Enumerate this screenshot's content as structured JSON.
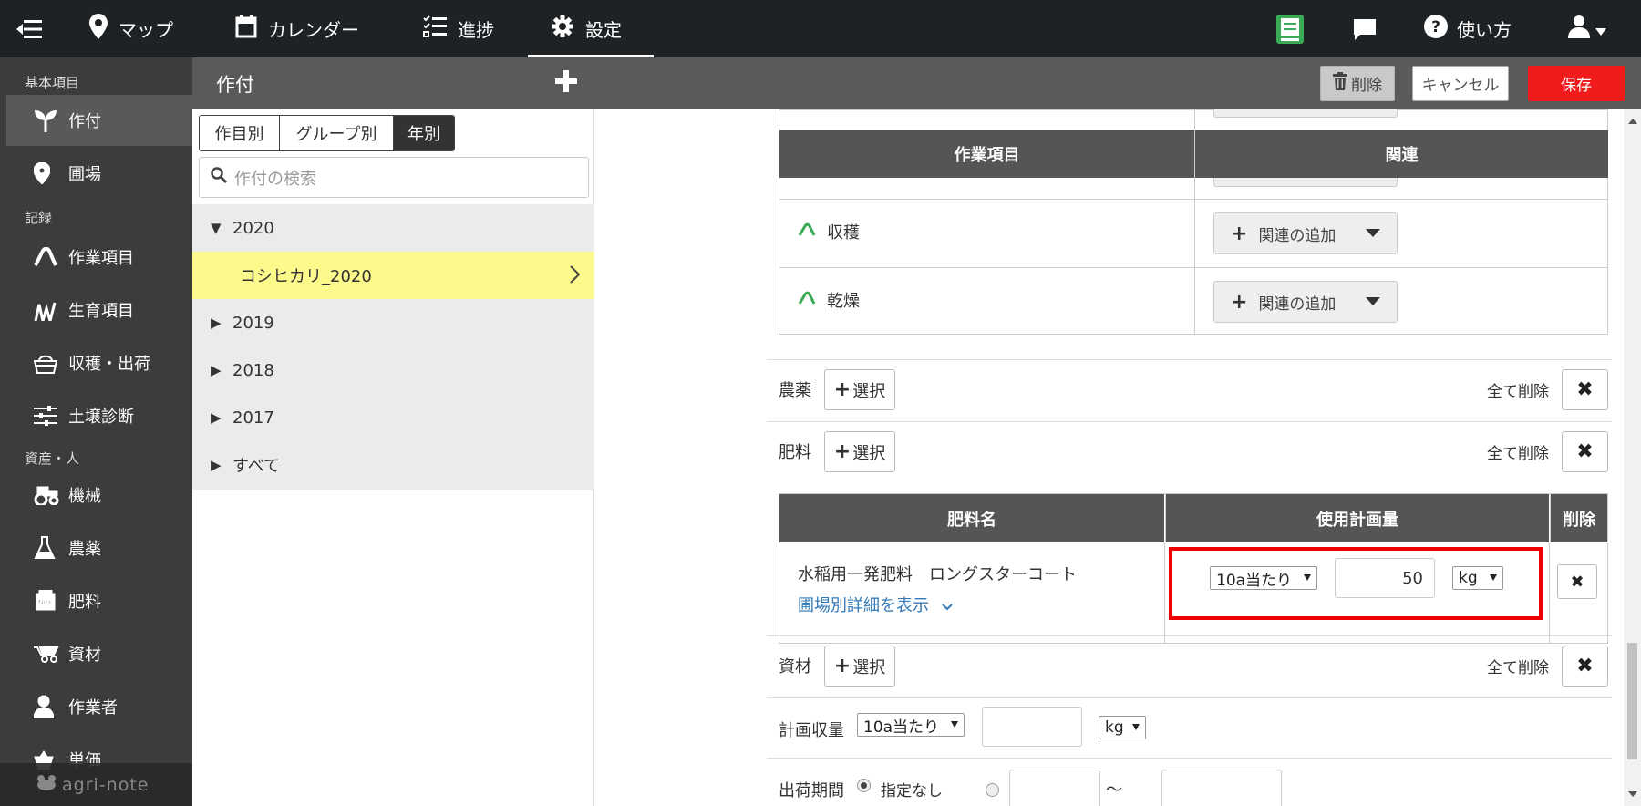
{
  "topbar": {
    "menu_icon": "collapse-menu-icon",
    "nav": [
      {
        "label": "マップ",
        "icon": "map-pin-icon"
      },
      {
        "label": "カレンダー",
        "icon": "calendar-icon"
      },
      {
        "label": "進捗",
        "icon": "checklist-icon"
      },
      {
        "label": "設定",
        "icon": "gear-icon"
      }
    ],
    "help_label": "使い方",
    "colors": {
      "bar": "#1f2225",
      "book_icon": "#3aaa55"
    }
  },
  "sidebar": {
    "section1": "基本項目",
    "section2": "記録",
    "section3": "資産・人",
    "items": [
      {
        "label": "作付",
        "icon": "sprout-icon"
      },
      {
        "label": "圃場",
        "icon": "location-pin-icon"
      },
      {
        "label": "作業項目",
        "icon": "work-item-icon"
      },
      {
        "label": "生育項目",
        "icon": "growth-icon"
      },
      {
        "label": "収穫・出荷",
        "icon": "basket-icon"
      },
      {
        "label": "土壌診断",
        "icon": "sliders-icon"
      },
      {
        "label": "機械",
        "icon": "tractor-icon"
      },
      {
        "label": "農薬",
        "icon": "flask-icon"
      },
      {
        "label": "肥料",
        "icon": "npk-icon"
      },
      {
        "label": "資材",
        "icon": "wheelbarrow-icon"
      },
      {
        "label": "作業者",
        "icon": "person-icon"
      },
      {
        "label": "単価",
        "icon": "price-icon"
      }
    ],
    "brand": "agri-note"
  },
  "header": {
    "title": "作付",
    "delete_label": "削除",
    "cancel_label": "キャンセル",
    "save_label": "保存",
    "colors": {
      "save": "#f01c1c"
    }
  },
  "list": {
    "tabs": [
      "作目別",
      "グループ別",
      "年別"
    ],
    "active_tab": "年別",
    "search_placeholder": "作付の検索",
    "tree": [
      {
        "label": "2020",
        "expanded": true
      },
      {
        "label": "コシヒカリ_2020",
        "selected": true
      },
      {
        "label": "2019"
      },
      {
        "label": "2018"
      },
      {
        "label": "2017"
      },
      {
        "label": "すべて"
      }
    ],
    "colors": {
      "selected": "#fdfa8c"
    }
  },
  "work_table": {
    "headers": [
      "作業項目",
      "関連"
    ],
    "rows": [
      {
        "name": "収穫",
        "action": "関連の追加"
      },
      {
        "name": "乾燥",
        "action": "関連の追加"
      }
    ]
  },
  "sections": {
    "pesticide_label": "農薬",
    "fertilizer_label": "肥料",
    "material_label": "資材",
    "select_label": "選択",
    "delete_all_label": "全て削除"
  },
  "fertilizer_table": {
    "headers": [
      "肥料名",
      "使用計画量",
      "削除"
    ],
    "row": {
      "name": "水稲用一発肥料　ロングスターコート",
      "detail_link": "圃場別詳細を表示",
      "basis": "10a当たり",
      "amount": "50",
      "unit": "kg"
    },
    "colors": {
      "highlight": "#e00000"
    }
  },
  "planned_yield": {
    "label": "計画収量",
    "basis": "10a当たり",
    "unit": "kg",
    "value": ""
  },
  "shipping_period": {
    "label": "出荷期間",
    "option_none": "指定なし",
    "separator": "〜"
  }
}
